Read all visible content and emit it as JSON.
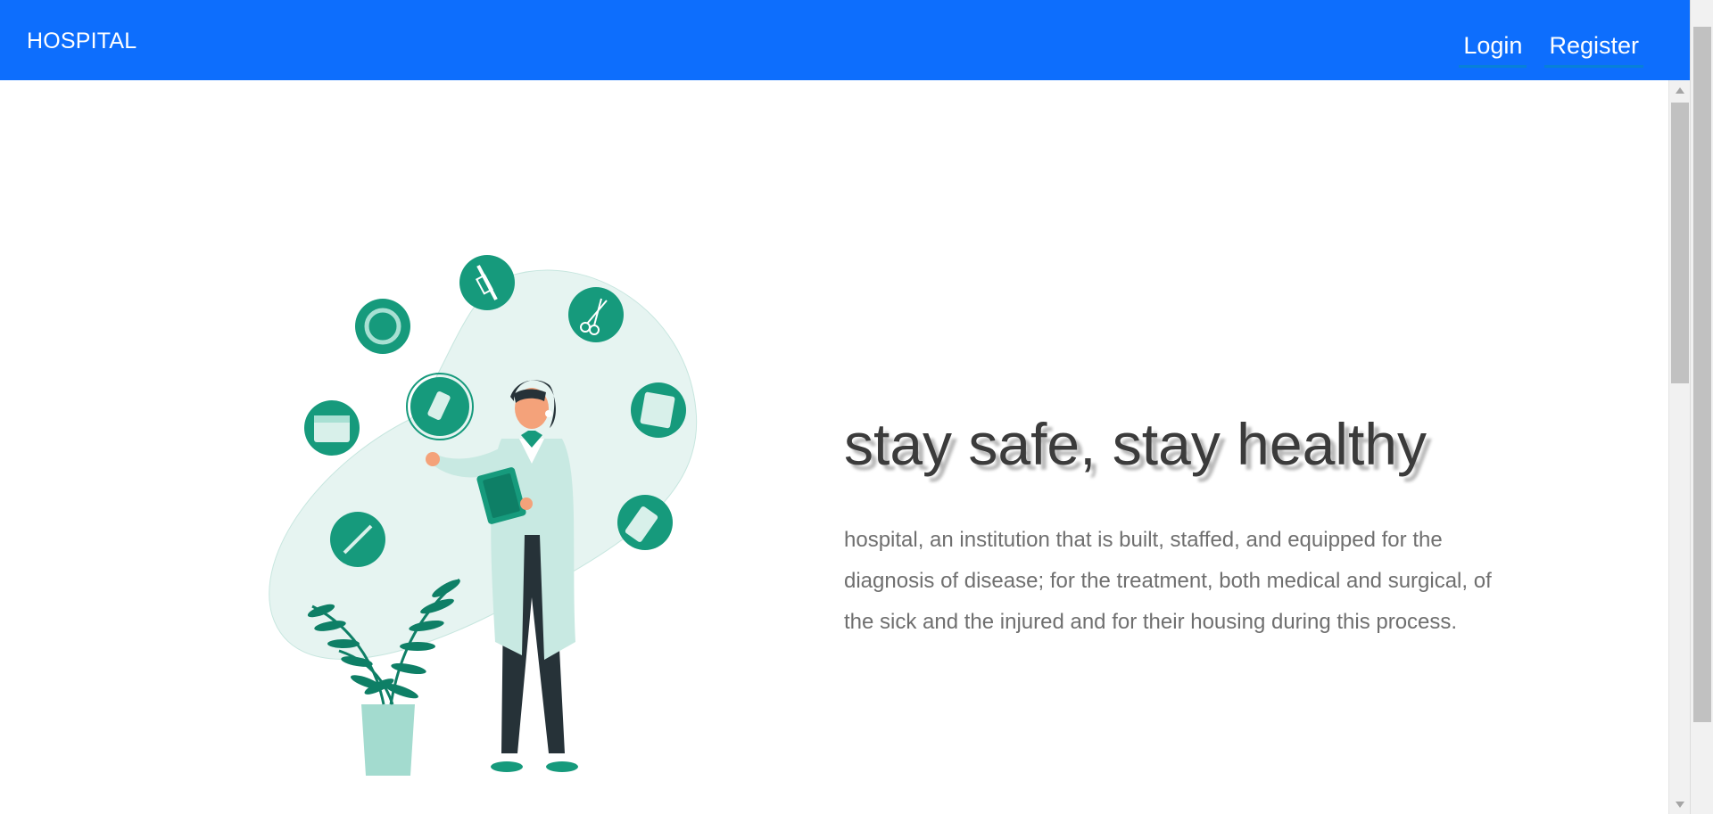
{
  "navbar": {
    "brand": "HOSPITAL",
    "links": [
      {
        "label": "Login"
      },
      {
        "label": "Register"
      }
    ],
    "background": "#0d6efd"
  },
  "hero": {
    "title": "stay safe, stay healthy",
    "description": "hospital, an institution that is built, staffed, and equipped for the diagnosis of disease; for the treatment, both medical and surgical, of the sick and the injured and for their housing during this process."
  },
  "illustration": {
    "icons": [
      "syringe-icon",
      "scissors-icon",
      "ring-icon",
      "calendar-icon",
      "document-icon",
      "pill-bottle-icon",
      "thermometer-icon",
      "pill-pack-icon"
    ],
    "accent": "#159a7c"
  }
}
